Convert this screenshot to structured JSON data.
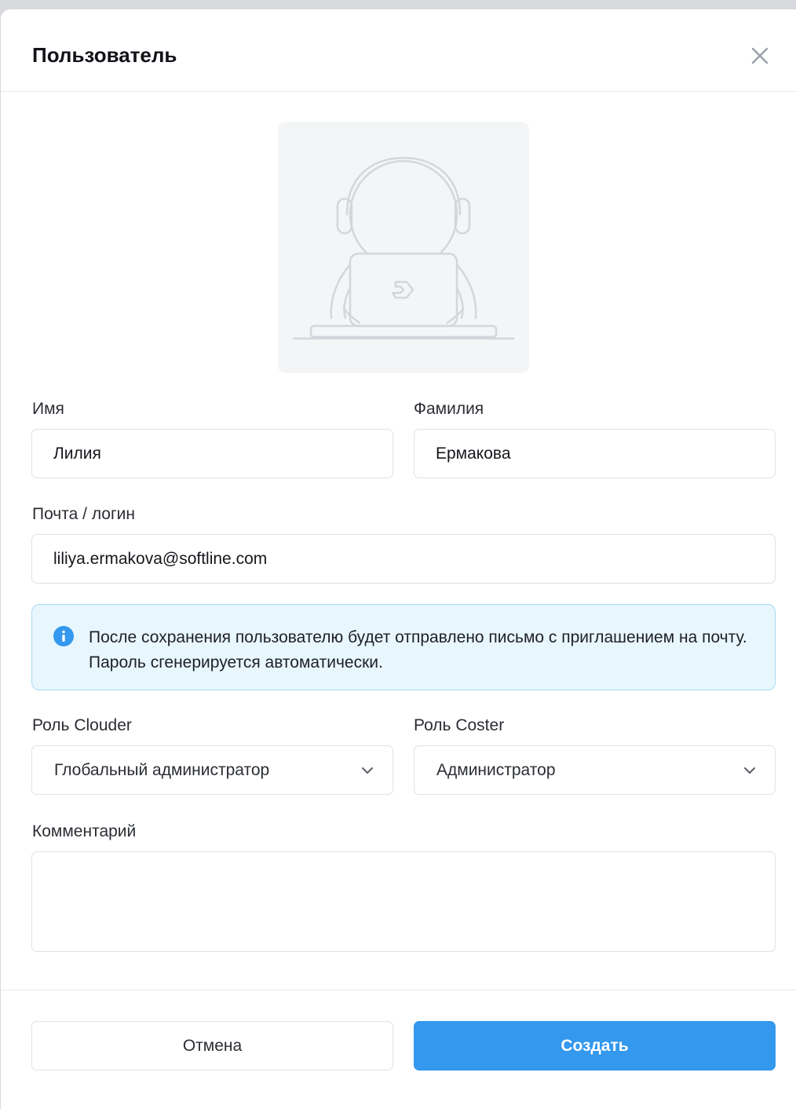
{
  "dialog": {
    "title": "Пользователь",
    "close_icon": "close-icon"
  },
  "avatar": {
    "icon": "astronaut-placeholder"
  },
  "form": {
    "first_name": {
      "label": "Имя",
      "value": "Лилия"
    },
    "last_name": {
      "label": "Фамилия",
      "value": "Ермакова"
    },
    "email": {
      "label": "Почта / логин",
      "value": "liliya.ermakova@softline.com"
    },
    "info_text": "После сохранения пользователю будет отправлено письмо с приглашением на почту. Пароль сгенерируется автоматически.",
    "role_clouder": {
      "label": "Роль Clouder",
      "value": "Глобальный администратор"
    },
    "role_coster": {
      "label": "Роль Coster",
      "value": "Администратор"
    },
    "comment": {
      "label": "Комментарий",
      "value": ""
    }
  },
  "actions": {
    "cancel": "Отмена",
    "create": "Создать"
  },
  "colors": {
    "primary": "#3398ee",
    "info_bg": "#e8f6fd",
    "info_border": "#a7daf3"
  }
}
